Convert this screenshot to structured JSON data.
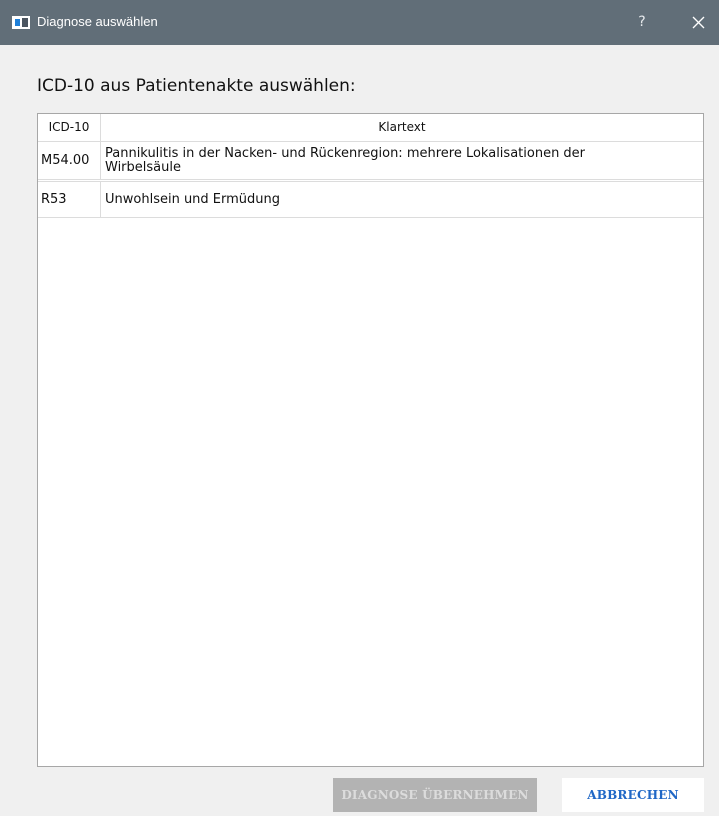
{
  "window": {
    "title": "Diagnose auswählen",
    "help_label": "?",
    "app_icon": "window-app-icon",
    "close_icon": "close-icon"
  },
  "prompt": "ICD-10 aus Patientenakte auswählen:",
  "table": {
    "headers": {
      "icd": "ICD-10",
      "text": "Klartext"
    },
    "rows": [
      {
        "icd": "M54.00",
        "text": "Pannikulitis in der Nacken- und Rückenregion: mehrere Lokalisationen der Wirbelsäule"
      },
      {
        "icd": "R53",
        "text": "Unwohlsein und Ermüdung"
      }
    ]
  },
  "buttons": {
    "apply": "DIAGNOSE ÜBERNEHMEN",
    "cancel": "ABBRECHEN"
  },
  "colors": {
    "titlebar": "#616e78",
    "cancel_text": "#1f67c6",
    "disabled_button": "#b3b3b3"
  }
}
